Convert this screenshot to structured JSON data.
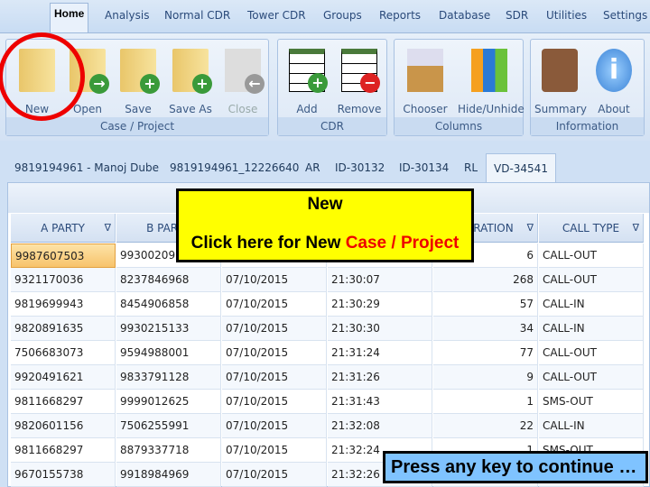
{
  "menu": [
    "Home",
    "Analysis",
    "Normal CDR",
    "Tower CDR",
    "Groups",
    "Reports",
    "Database",
    "SDR",
    "Utilities",
    "Settings"
  ],
  "ribbon": {
    "case_project": {
      "label": "Case / Project",
      "buttons": [
        "New",
        "Open",
        "Save",
        "Save As",
        "Close"
      ]
    },
    "cdr": {
      "label": "CDR",
      "buttons": [
        "Add",
        "Remove"
      ]
    },
    "columns": {
      "label": "Columns",
      "buttons": [
        "Chooser",
        "Hide/Unhide"
      ]
    },
    "information": {
      "label": "Information",
      "buttons": [
        "Summary",
        "About"
      ]
    }
  },
  "doc_tabs": [
    "9819194961 - Manoj Dube",
    "9819194961_12226640",
    "AR",
    "ID-30132",
    "ID-30134",
    "RL",
    "VD-34541"
  ],
  "grid": {
    "headers": [
      "A PARTY",
      "B PARTY",
      "",
      "",
      "DURATION",
      "CALL TYPE"
    ],
    "rows": [
      [
        "9987607503",
        "993002097",
        "",
        "",
        "6",
        "CALL-OUT"
      ],
      [
        "9321170036",
        "8237846968",
        "07/10/2015",
        "21:30:07",
        "268",
        "CALL-OUT"
      ],
      [
        "9819699943",
        "8454906858",
        "07/10/2015",
        "21:30:29",
        "57",
        "CALL-IN"
      ],
      [
        "9820891635",
        "9930215133",
        "07/10/2015",
        "21:30:30",
        "34",
        "CALL-IN"
      ],
      [
        "7506683073",
        "9594988001",
        "07/10/2015",
        "21:31:24",
        "77",
        "CALL-OUT"
      ],
      [
        "9920491621",
        "9833791128",
        "07/10/2015",
        "21:31:26",
        "9",
        "CALL-OUT"
      ],
      [
        "9811668297",
        "9999012625",
        "07/10/2015",
        "21:31:43",
        "1",
        "SMS-OUT"
      ],
      [
        "9820601156",
        "7506255991",
        "07/10/2015",
        "21:32:08",
        "22",
        "CALL-IN"
      ],
      [
        "9811668297",
        "8879337718",
        "07/10/2015",
        "21:32:24",
        "1",
        "SMS-OUT"
      ],
      [
        "9670155738",
        "9918984969",
        "07/10/2015",
        "21:32:26",
        "",
        ""
      ]
    ]
  },
  "callout": {
    "title": "New",
    "text": "Click here for New ",
    "highlight": "Case / Project"
  },
  "press": "Press any key to continue …",
  "colors": {
    "highlight": "#ff0000",
    "callout_bg": "#ffff00",
    "press_bg": "#7fc3ff"
  }
}
